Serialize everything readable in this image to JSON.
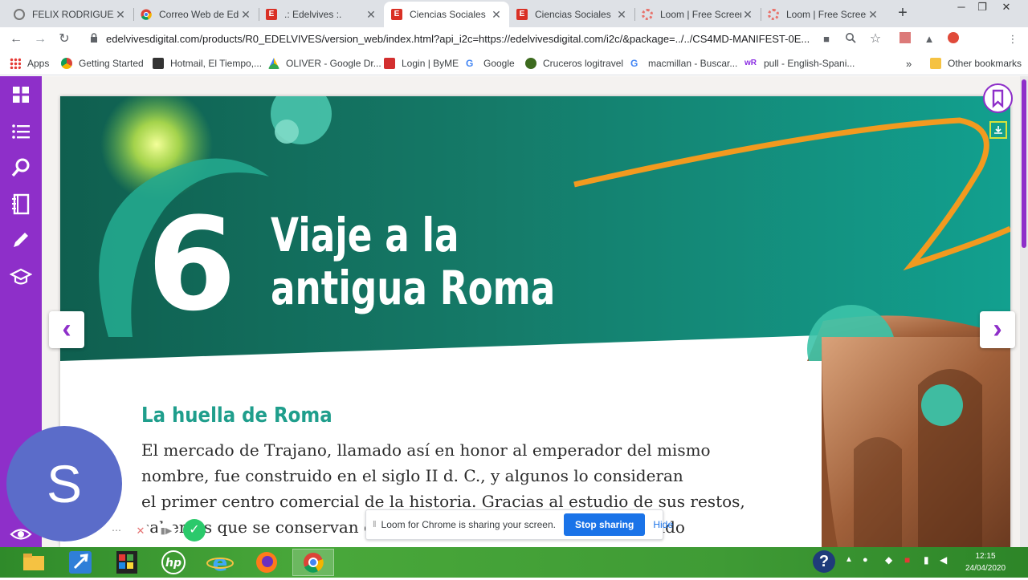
{
  "browser": {
    "tabs": [
      {
        "title": "FELIX RODRIGUEZ I",
        "favicon": "globe-icon",
        "active": false
      },
      {
        "title": "Correo Web de Edu",
        "favicon": "chrome-icon",
        "active": false
      },
      {
        "title": ".: Edelvives :.",
        "favicon": "edelvives-icon",
        "active": false
      },
      {
        "title": "Ciencias Sociales",
        "favicon": "edelvives-icon",
        "active": true
      },
      {
        "title": "Ciencias Sociales",
        "favicon": "edelvives-icon",
        "active": false
      },
      {
        "title": "Loom | Free Screen",
        "favicon": "loom-icon",
        "active": false
      },
      {
        "title": "Loom | Free Screen",
        "favicon": "loom-icon",
        "active": false
      }
    ],
    "url": "edelvivesdigital.com/products/R0_EDELVIVES/version_web/index.html?api_i2c=https://edelvivesdigital.com/i2c/&package=../../CS4MD-MANIFEST-0E...",
    "profile_initial": "S",
    "bookmarks": [
      {
        "label": "Apps",
        "icon": "apps-grid-icon"
      },
      {
        "label": "Getting Started",
        "icon": "chrome-icon"
      },
      {
        "label": "Hotmail, El Tiempo,...",
        "icon": "msn-icon"
      },
      {
        "label": "OLIVER - Google Dr...",
        "icon": "google-drive-icon"
      },
      {
        "label": "Login | ByME",
        "icon": "byme-icon"
      },
      {
        "label": "Google",
        "icon": "google-icon"
      },
      {
        "label": "Cruceros logitravel",
        "icon": "logitravel-icon"
      },
      {
        "label": "macmillan - Buscar...",
        "icon": "google-icon"
      },
      {
        "label": "pull - English-Spani...",
        "icon": "wordreference-icon"
      }
    ],
    "bookmarks_overflow": "»",
    "other_bookmarks": "Other bookmarks"
  },
  "book": {
    "chapter_number": "6",
    "chapter_title_line1": "Viaje a la",
    "chapter_title_line2": "antigua Roma",
    "section_title": "La huella de Roma",
    "body_lines": [
      "El mercado de Trajano, llamado así en honor al emperador del mismo",
      "nombre, fue construido en el siglo II d. C., y algunos lo consideran",
      "el primer centro comercial de la historia. Gracias al estudio de sus restos,",
      "sabemos que se conservan en la ciudad de Roma; en este mercado"
    ]
  },
  "loom": {
    "avatar_initial": "S",
    "sharing_message": "Loom for Chrome is sharing your screen.",
    "stop_label": "Stop sharing",
    "hide_label": "Hide"
  },
  "taskbar": {
    "time": "12:15",
    "date": "24/04/2020"
  },
  "colors": {
    "sidebar": "#8e2fc9",
    "banner_teal": "#1a8a78",
    "heading_teal": "#1f9e8c",
    "loom_blue": "#1a73e8"
  }
}
